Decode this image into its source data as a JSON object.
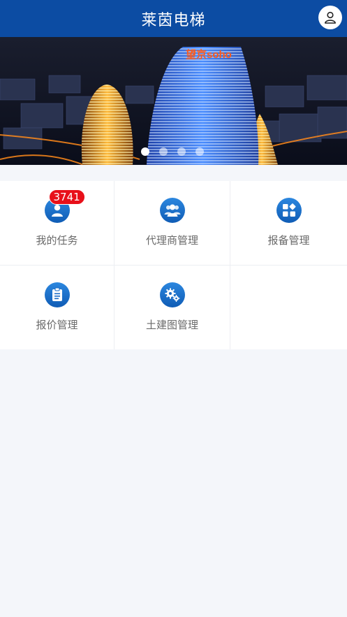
{
  "header": {
    "title": "莱茵电梯",
    "profile_icon": "user-icon"
  },
  "banner": {
    "building_sign": "望京soho",
    "slides": 4,
    "active_slide": 1
  },
  "menu": [
    {
      "label": "我的任务",
      "icon": "user-icon",
      "badge": "3741"
    },
    {
      "label": "代理商管理",
      "icon": "group-icon"
    },
    {
      "label": "报备管理",
      "icon": "apps-grid-icon"
    },
    {
      "label": "报价管理",
      "icon": "clipboard-icon"
    },
    {
      "label": "土建图管理",
      "icon": "gears-icon"
    }
  ],
  "colors": {
    "header": "#0c4ca3",
    "icon": "#1b6fcb",
    "badge": "#e8101a",
    "background": "#f4f6fa"
  }
}
